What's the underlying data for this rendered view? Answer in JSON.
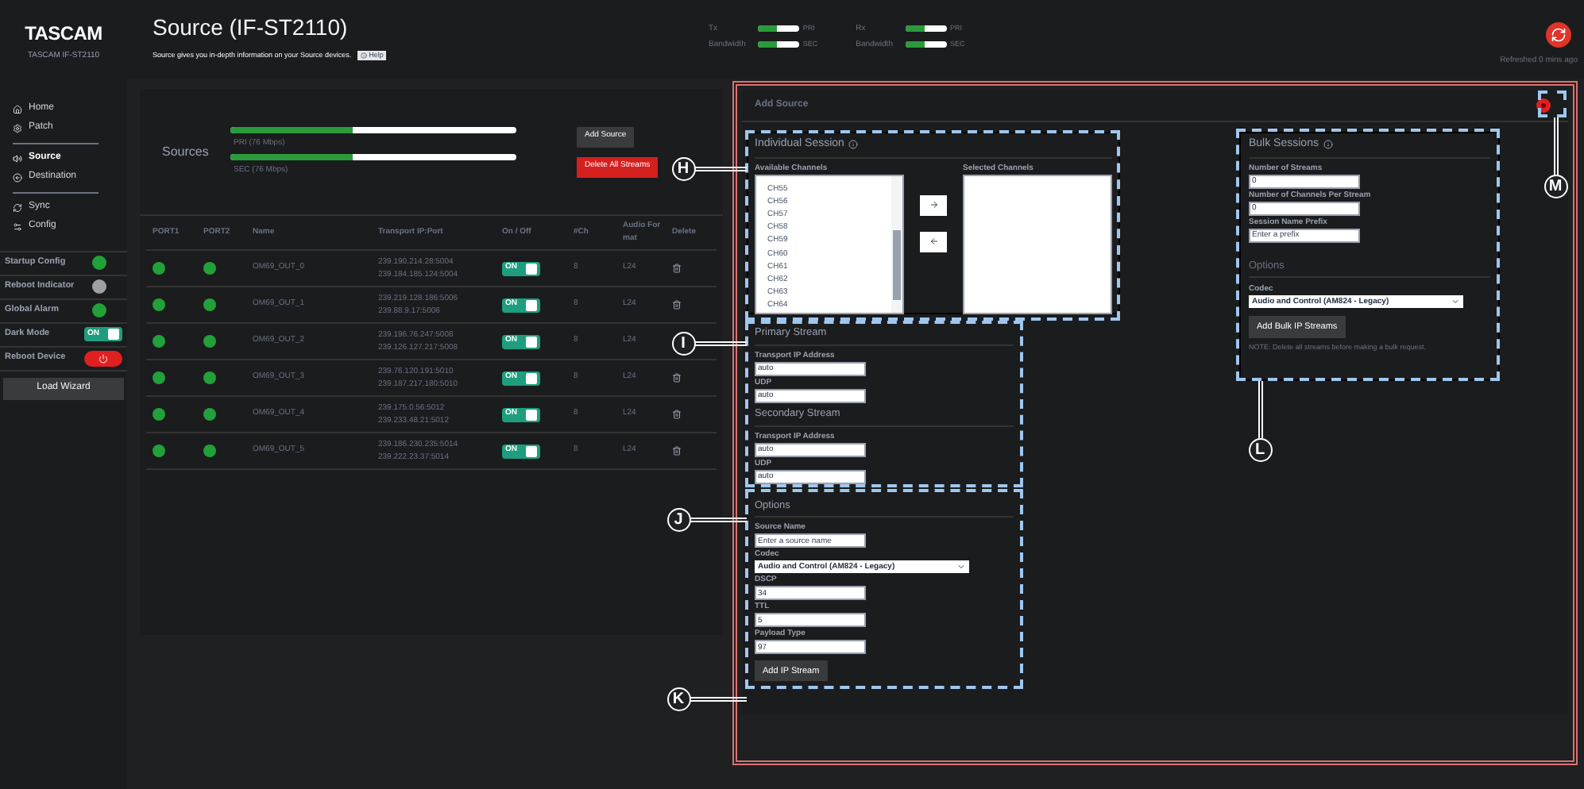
{
  "brand": {
    "logo": "TASCAM",
    "model": "TASCAM IF-ST2110"
  },
  "nav": [
    [
      {
        "label": "Home",
        "selected": false
      },
      {
        "label": "Patch",
        "selected": false
      }
    ],
    [
      {
        "label": "Source",
        "selected": true
      },
      {
        "label": "Destination",
        "selected": false
      }
    ],
    [
      {
        "label": "Sync",
        "selected": false
      },
      {
        "label": "Config",
        "selected": false
      }
    ]
  ],
  "status": [
    {
      "label": "Startup Config",
      "kind": "dot",
      "color": "#22a03a"
    },
    {
      "label": "Reboot Indicator",
      "kind": "dot",
      "color": "#a0a0a0"
    },
    {
      "label": "Global Alarm",
      "kind": "dot",
      "color": "#22a03a"
    },
    {
      "label": "Dark Mode",
      "kind": "toggle",
      "on": true,
      "text": "ON"
    },
    {
      "label": "Reboot Device",
      "kind": "power"
    }
  ],
  "load_wizard": "Load Wizard",
  "page": {
    "title": "Source (IF-ST2110)",
    "description": "Source gives you in-depth information on your Source devices.",
    "help": "Help"
  },
  "bandwidth": [
    {
      "label": "Tx",
      "sublabel": "Bandwidth",
      "meters": [
        {
          "name": "PRI",
          "level": 0.45
        },
        {
          "name": "SEC",
          "level": 0.45
        }
      ]
    },
    {
      "label": "Rx",
      "sublabel": "Bandwidth",
      "meters": [
        {
          "name": "PRI",
          "level": 0.45
        },
        {
          "name": "SEC",
          "level": 0.45
        }
      ]
    }
  ],
  "refreshed": "Refreshed 0 mins ago",
  "sources": {
    "title": "Sources",
    "meters": [
      {
        "label": "PRI (76 Mbps)",
        "level": 0.43
      },
      {
        "label": "SEC (76 Mbps)",
        "level": 0.43
      }
    ],
    "add": "Add Source",
    "delete_all": "Delete All Streams"
  },
  "table": {
    "columns": [
      "PORT1",
      "PORT2",
      "Name",
      "Transport IP:Port",
      "On / Off",
      "#Ch",
      "Audio Format",
      "Delete"
    ],
    "rows": [
      {
        "port1_up": true,
        "port2_up": true,
        "name": "OM69_OUT_0",
        "ips": [
          "239.190.214.28:5004",
          "239.184.185.124:5004"
        ],
        "on": true,
        "toggle": "ON",
        "ch": "8",
        "format": "L24"
      },
      {
        "port1_up": true,
        "port2_up": true,
        "name": "OM69_OUT_1",
        "ips": [
          "239.219.128.186:5006",
          "239.88.9.17:5006"
        ],
        "on": true,
        "toggle": "ON",
        "ch": "8",
        "format": "L24"
      },
      {
        "port1_up": true,
        "port2_up": true,
        "name": "OM69_OUT_2",
        "ips": [
          "239.196.76.247:5008",
          "239.126.127.217:5008"
        ],
        "on": true,
        "toggle": "ON",
        "ch": "8",
        "format": "L24"
      },
      {
        "port1_up": true,
        "port2_up": true,
        "name": "OM69_OUT_3",
        "ips": [
          "239.76.120.191:5010",
          "239.187.217.180:5010"
        ],
        "on": true,
        "toggle": "ON",
        "ch": "8",
        "format": "L24"
      },
      {
        "port1_up": true,
        "port2_up": true,
        "name": "OM69_OUT_4",
        "ips": [
          "239.175.0.56:5012",
          "239.233.48.21:5012"
        ],
        "on": true,
        "toggle": "ON",
        "ch": "8",
        "format": "L24"
      },
      {
        "port1_up": true,
        "port2_up": true,
        "name": "OM69_OUT_5",
        "ips": [
          "239.186.230.235:5014",
          "239.222.23.37:5014"
        ],
        "on": true,
        "toggle": "ON",
        "ch": "8",
        "format": "L24"
      }
    ]
  },
  "modal": {
    "title": "Add Source",
    "individual": {
      "title": "Individual Session",
      "available_label": "Available Channels",
      "channels": [
        "CH55",
        "CH56",
        "CH57",
        "CH58",
        "CH59",
        "CH60",
        "CH61",
        "CH62",
        "CH63",
        "CH64"
      ],
      "selected_label": "Selected Channels"
    },
    "streams": [
      {
        "title": "Primary Stream",
        "fields": [
          {
            "kind": "input",
            "label": "Transport IP Address",
            "value": "auto"
          },
          {
            "kind": "input",
            "label": "UDP",
            "value": "auto"
          }
        ]
      },
      {
        "title": "Secondary Stream",
        "fields": [
          {
            "kind": "input",
            "label": "Transport IP Address",
            "value": "auto"
          },
          {
            "kind": "input",
            "label": "UDP",
            "value": "auto"
          }
        ]
      }
    ],
    "options": {
      "title": "Options",
      "fields": [
        {
          "kind": "input",
          "label": "Source Name",
          "placeholder": "Enter a source name"
        },
        {
          "kind": "select",
          "label": "Codec",
          "value": "Audio and Control (AM824 - Legacy)"
        },
        {
          "kind": "input",
          "label": "DSCP",
          "value": "34"
        },
        {
          "kind": "input",
          "label": "TTL",
          "value": "5"
        },
        {
          "kind": "input",
          "label": "Payload Type",
          "value": "97"
        }
      ]
    },
    "add_button": "Add IP Stream",
    "bulk": {
      "title": "Bulk Sessions",
      "fields": [
        {
          "kind": "input",
          "label": "Number of Streams",
          "value": "0"
        },
        {
          "kind": "input",
          "label": "Number of Channels Per Stream",
          "value": "0"
        },
        {
          "kind": "input",
          "label": "Session Name Prefix",
          "placeholder": "Enter a prefix"
        }
      ],
      "options_title": "Options",
      "codec": {
        "kind": "select",
        "label": "Codec",
        "value": "Audio and Control (AM824 - Legacy)"
      },
      "button": "Add Bulk IP Streams",
      "note": "NOTE: Delete all streams before making a bulk request."
    }
  },
  "callouts": [
    "H",
    "I",
    "J",
    "K",
    "L",
    "M"
  ]
}
